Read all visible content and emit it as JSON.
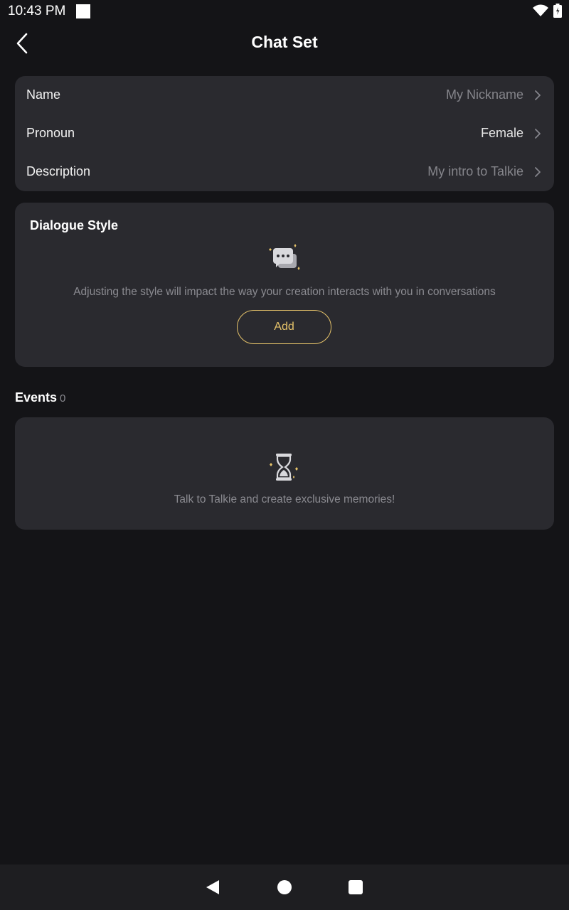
{
  "status_bar": {
    "time": "10:43 PM",
    "icons": [
      "notification-square-icon",
      "wifi-icon",
      "battery-icon"
    ]
  },
  "header": {
    "title": "Chat Set",
    "back_icon": "chevron-left-icon"
  },
  "profile": {
    "rows": [
      {
        "label": "Name",
        "value": "My Nickname"
      },
      {
        "label": "Pronoun",
        "value": "Female"
      },
      {
        "label": "Description",
        "value": "My intro to Talkie"
      }
    ]
  },
  "dialogue_style": {
    "title": "Dialogue Style",
    "icon": "chat-bubbles-sparkle-icon",
    "hint": "Adjusting the style will impact the way your creation interacts with you in conversations",
    "add_label": "Add"
  },
  "events": {
    "title": "Events",
    "count": "0",
    "icon": "hourglass-sparkle-icon",
    "empty_hint": "Talk to Talkie and create exclusive memories!"
  },
  "nav_bar": {
    "icons": [
      "nav-back-icon",
      "nav-home-icon",
      "nav-recents-icon"
    ]
  },
  "colors": {
    "background": "#141417",
    "card": "#2a2a2f",
    "accent": "#e6c36a",
    "muted_text": "#8a8a90"
  }
}
